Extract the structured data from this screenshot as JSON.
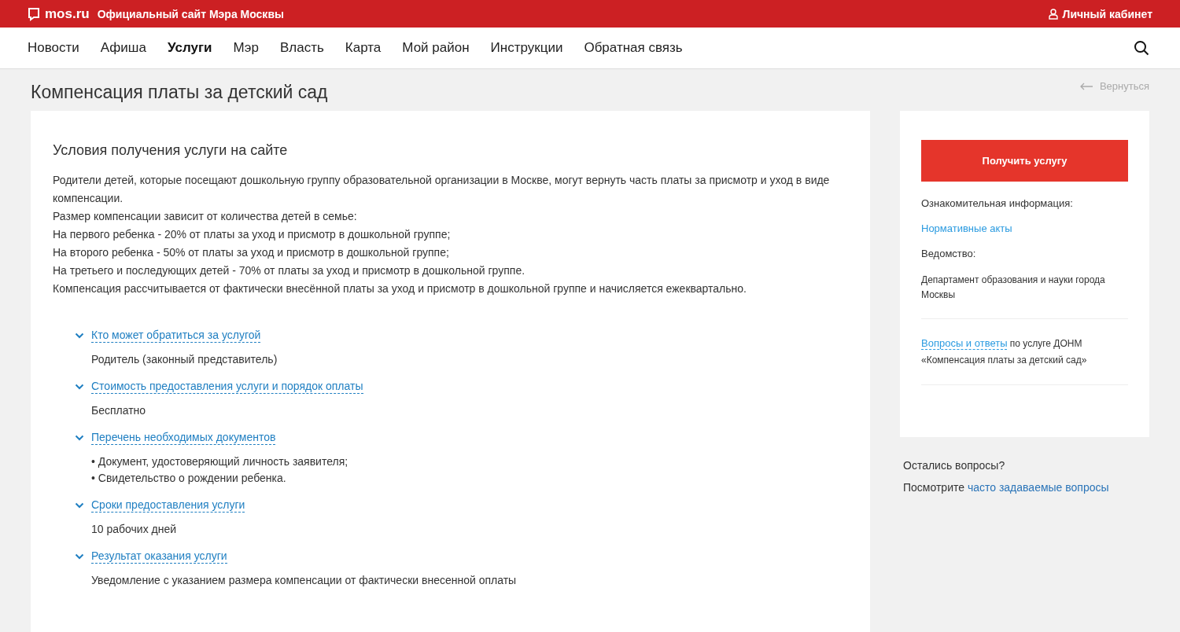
{
  "header": {
    "logo": "mos.ru",
    "site_title": "Официальный сайт Мэра Москвы",
    "account": "Личный кабинет"
  },
  "nav": [
    {
      "label": "Новости",
      "selected": false
    },
    {
      "label": "Афиша",
      "selected": false
    },
    {
      "label": "Услуги",
      "selected": true
    },
    {
      "label": "Мэр",
      "selected": false
    },
    {
      "label": "Власть",
      "selected": false
    },
    {
      "label": "Карта",
      "selected": false
    },
    {
      "label": "Мой район",
      "selected": false
    },
    {
      "label": "Инструкции",
      "selected": false
    },
    {
      "label": "Обратная связь",
      "selected": false
    }
  ],
  "page_title": "Компенсация платы за детский сад",
  "back_link": "Вернуться",
  "main": {
    "heading": "Условия получения услуги на сайте",
    "intro": [
      "Родители детей, которые посещают дошкольную группу образовательной организации в Москве, могут вернуть часть платы за присмотр и уход в виде компенсации.",
      "Размер компенсации зависит от количества детей в семье:",
      "На первого ребенка - 20% от платы за уход и присмотр в дошкольной группе;",
      "На второго ребенка - 50% от платы за уход и присмотр в дошкольной группе;",
      "На третьего и последующих детей - 70% от платы за уход и присмотр в дошкольной группе.",
      "Компенсация рассчитывается от фактически внесённой платы за уход и присмотр в дошкольной группе и начисляется ежеквартально."
    ],
    "sections": [
      {
        "title": "Кто может обратиться за услугой",
        "expanded": true,
        "lines": [
          "Родитель (законный представитель)"
        ]
      },
      {
        "title": "Стоимость предоставления услуги и порядок оплаты",
        "expanded": true,
        "lines": [
          "Бесплатно"
        ]
      },
      {
        "title": "Перечень необходимых документов",
        "expanded": true,
        "lines": [
          "• Документ, удостоверяющий личность заявителя;",
          "• Свидетельство о рождении ребенка."
        ]
      },
      {
        "title": "Сроки предоставления услуги",
        "expanded": true,
        "lines": [
          "10 рабочих дней"
        ]
      },
      {
        "title": "Результат оказания услуги",
        "expanded": true,
        "lines": [
          "Уведомление с указанием размера компенсации от фактически внесенной оплаты"
        ]
      }
    ]
  },
  "sidebar": {
    "button": "Получить услугу",
    "info_label": "Ознакомительная информация:",
    "info_link": "Нормативные акты",
    "agency_label": "Ведомство:",
    "agency": "Департамент образования и науки города Москвы",
    "faq_link": "Вопросы и ответы",
    "faq_text": " по услуге ДОНМ «Компенсация платы за детский сад»"
  },
  "help": {
    "question": "Остались вопросы?",
    "prefix": "Посмотрите ",
    "link": "часто задаваемые вопросы"
  }
}
